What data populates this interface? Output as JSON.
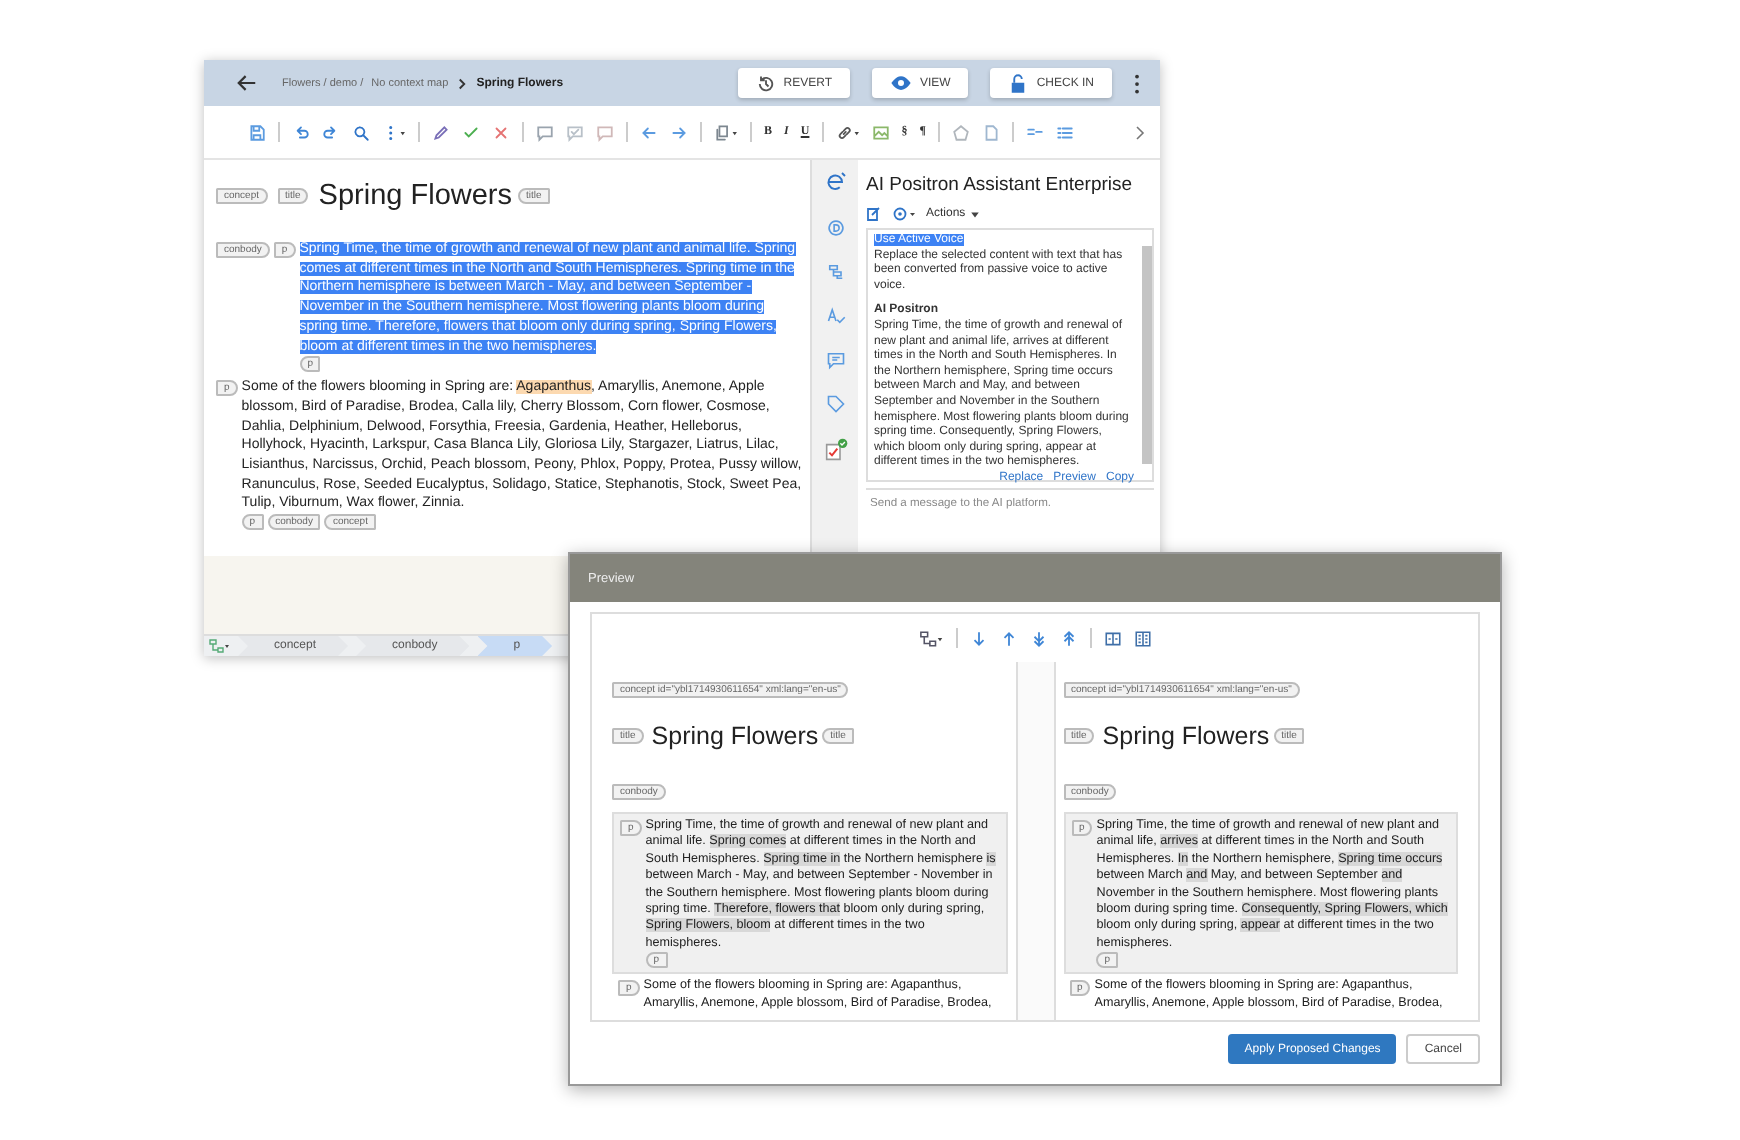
{
  "editor": {
    "breadcrumb": {
      "path": "Flowers / demo /",
      "context": "No context map",
      "current": "Spring Flowers"
    },
    "buttons": [
      {
        "label": "REVERT"
      },
      {
        "label": "VIEW"
      },
      {
        "label": "CHECK IN"
      }
    ],
    "format_buttons": [
      "B",
      "I",
      "U",
      "§",
      "¶"
    ],
    "title": {
      "before": [
        {
          "label": "concept",
          "kind": "open"
        },
        {
          "label": "title",
          "kind": "open"
        }
      ],
      "text": "Spring Flowers",
      "after": [
        {
          "label": "title",
          "kind": "close"
        }
      ]
    },
    "paragraphs": [
      {
        "selected": true,
        "before": [
          {
            "label": "conbody",
            "kind": "open"
          },
          {
            "label": "p",
            "kind": "open"
          }
        ],
        "segments": [
          {
            "text": "Spring Time, the time of growth and renewal of new plant and animal life. Spring comes at different times in the North and South Hemispheres. Spring time in the Northern hemisphere is between March - May, and between September - November in the Southern hemisphere. Most flowering plants bloom during spring time. Therefore, flowers that bloom only during spring, Spring Flowers, bloom at different times in the two hemispheres.",
            "highlighted": false
          }
        ],
        "after": [
          {
            "label": "p",
            "kind": "close"
          }
        ]
      },
      {
        "selected": false,
        "before": [
          {
            "label": "p",
            "kind": "open"
          }
        ],
        "segments": [
          {
            "text": "Some of the flowers blooming in Spring are: ",
            "highlighted": false
          },
          {
            "text": "Agapanthus",
            "highlighted": true
          },
          {
            "text": ", Amaryllis, Anemone, Apple blossom, Bird of Paradise, Brodea, Calla lily, Cherry Blossom, Corn flower, Cosmose, Dahlia, Delphinium, Delwood, Forsythia, Freesia, Gardenia, Heather, Helleborus, Hollyhock, Hyacinth, Larkspur, Casa Blanca Lily, Gloriosa Lily, Stargazer, Liatrus, Lilac, Lisianthus, Narcissus, Orchid, Peach blossom, Peony, Phlox, Poppy, Protea, Pussy willow, Ranunculus, Rose, Seeded Eucalyptus, Solidago, Statice, Stephanotis, Stock, Sweet Pea, Tulip, Viburnum, Wax flower, Zinnia.",
            "highlighted": false
          }
        ],
        "after": [
          {
            "label": "p",
            "kind": "close"
          },
          {
            "label": "conbody",
            "kind": "close"
          },
          {
            "label": "concept",
            "kind": "close"
          }
        ]
      }
    ],
    "status_path": [
      {
        "label": "concept",
        "selected": false
      },
      {
        "label": "conbody",
        "selected": false
      },
      {
        "label": "p",
        "selected": true
      }
    ]
  },
  "ai_assistant": {
    "title": "AI Positron Assistant Enterprise",
    "actions_label": "Actions",
    "command": "Use Active Voice",
    "command_selected": true,
    "description": "Replace the selected content with text that has been converted from passive voice to active voice.",
    "source": "AI Positron",
    "response": "Spring Time, the time of growth and renewal of new plant and animal life, arrives at different times in the North and South Hemispheres. In the Northern hemisphere, Spring time occurs between March and May, and between September and November in the Southern hemisphere. Most flowering plants bloom during spring time. Consequently, Spring Flowers, which bloom only during spring, appear at different times in the two hemispheres.",
    "links": [
      "Replace",
      "Preview",
      "Copy"
    ],
    "message_placeholder": "Send a message to the AI platform."
  },
  "preview": {
    "title": "Preview",
    "panes": [
      {
        "root_tag": "concept id=\"ybl1714930611654\" xml:lang=\"en-us\"",
        "title_tag": "title",
        "title": "Spring Flowers",
        "title_close_tag": "title",
        "body_tag": "conbody",
        "paragraphs": [
          {
            "changed": true,
            "before": "p",
            "after": "p",
            "segments": [
              {
                "text": "Spring Time, the time of growth and renewal of new plant and animal life. ",
                "changed": false
              },
              {
                "text": "Spring comes",
                "changed": true
              },
              {
                "text": " at different times in the North and South Hemispheres. ",
                "changed": false
              },
              {
                "text": "Spring time in",
                "changed": true
              },
              {
                "text": " the Northern hemisphere ",
                "changed": false
              },
              {
                "text": "is",
                "changed": true
              },
              {
                "text": " between March - May, and between September - November in the Southern hemisphere. Most flowering plants bloom during spring time. ",
                "changed": false
              },
              {
                "text": "Therefore, flowers that",
                "changed": true
              },
              {
                "text": " bloom only during spring, ",
                "changed": false
              },
              {
                "text": "Spring Flowers, bloom",
                "changed": true
              },
              {
                "text": " at different times in the two hemispheres.",
                "changed": false
              }
            ]
          },
          {
            "changed": false,
            "before": "p",
            "segments": [
              {
                "text": "Some of the flowers blooming in Spring are: Agapanthus, Amaryllis, Anemone, Apple blossom, Bird of Paradise, Brodea,",
                "changed": false
              }
            ]
          }
        ]
      },
      {
        "root_tag": "concept id=\"ybl1714930611654\" xml:lang=\"en-us\"",
        "title_tag": "title",
        "title": "Spring Flowers",
        "title_close_tag": "title",
        "body_tag": "conbody",
        "paragraphs": [
          {
            "changed": true,
            "before": "p",
            "after": "p",
            "segments": [
              {
                "text": "Spring Time, the time of growth and renewal of new plant and animal life, ",
                "changed": false
              },
              {
                "text": "arrives",
                "changed": true
              },
              {
                "text": " at different times in the North and South Hemispheres. ",
                "changed": false
              },
              {
                "text": "In",
                "changed": true
              },
              {
                "text": " the Northern hemisphere, ",
                "changed": false
              },
              {
                "text": "Spring time occurs",
                "changed": true
              },
              {
                "text": " between March ",
                "changed": false
              },
              {
                "text": "and",
                "changed": true
              },
              {
                "text": " May, and between September ",
                "changed": false
              },
              {
                "text": "and",
                "changed": true
              },
              {
                "text": " November in the Southern hemisphere. Most flowering plants bloom during spring time. ",
                "changed": false
              },
              {
                "text": "Consequently, Spring Flowers, which",
                "changed": true
              },
              {
                "text": " bloom only during spring, ",
                "changed": false
              },
              {
                "text": "appear",
                "changed": true
              },
              {
                "text": " at different times in the two hemispheres.",
                "changed": false
              }
            ]
          },
          {
            "changed": false,
            "before": "p",
            "segments": [
              {
                "text": "Some of the flowers blooming in Spring are: Agapanthus, Amaryllis, Anemone, Apple blossom, Bird of Paradise, Brodea,",
                "changed": false
              }
            ]
          }
        ]
      }
    ],
    "buttons": [
      {
        "label": "Apply Proposed Changes",
        "kind": "primary"
      },
      {
        "label": "Cancel",
        "kind": "secondary"
      }
    ]
  }
}
